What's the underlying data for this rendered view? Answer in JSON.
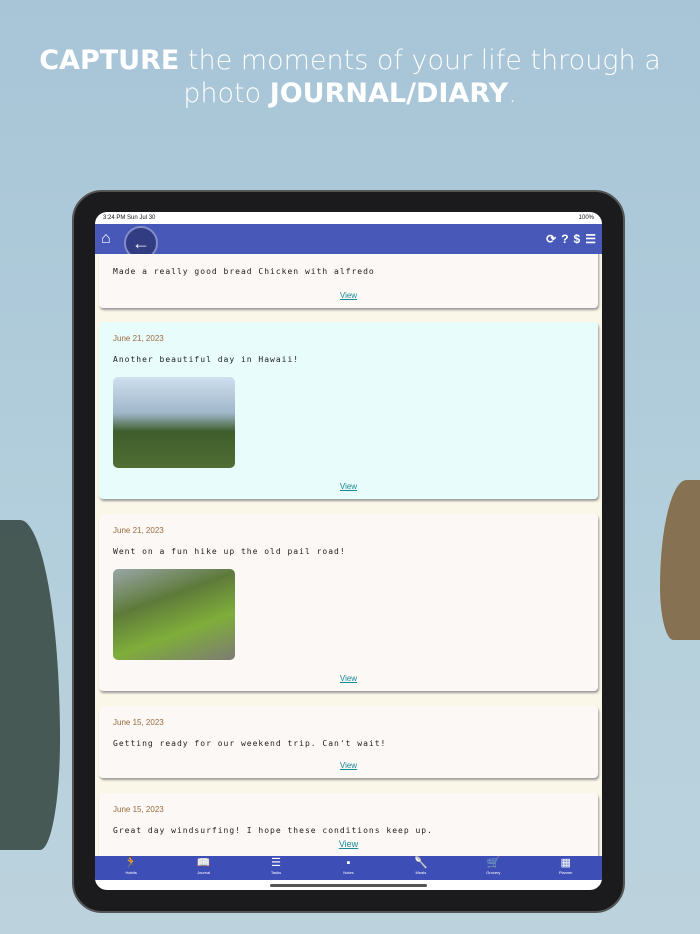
{
  "headline": {
    "strong1": "CAPTURE",
    "mid": " the moments of your life through a photo ",
    "strong2": "JOURNAL/DIARY",
    "end": "."
  },
  "status": {
    "time": "3:24 PM  Sun Jul 30",
    "battery": "100%"
  },
  "topbar": {
    "home": "⌂",
    "back": "←",
    "icons": [
      "⟳",
      "?",
      "$",
      "☰"
    ]
  },
  "entries": [
    {
      "date": "",
      "text": "Made a really good bread Chicken with alfredo",
      "view": "View",
      "photo": false
    },
    {
      "date": "June 21, 2023",
      "text": "Another beautiful day in Hawaii!",
      "view": "View",
      "photo": true
    },
    {
      "date": "June 21, 2023",
      "text": "Went on a fun hike up the old pail road!",
      "view": "View",
      "photo": true
    },
    {
      "date": "June 15, 2023",
      "text": "Getting ready for our weekend trip. Can't wait!",
      "view": "View",
      "photo": false
    },
    {
      "date": "June 15, 2023",
      "text": "Great day windsurfing! I hope these conditions keep up.",
      "view": "View",
      "photo": false
    }
  ],
  "nav": [
    {
      "icon": "🏃",
      "label": "Habits"
    },
    {
      "icon": "📖",
      "label": "Journal"
    },
    {
      "icon": "☰",
      "label": "Tasks"
    },
    {
      "icon": "▪",
      "label": "Notes"
    },
    {
      "icon": "🥄",
      "label": "Meals"
    },
    {
      "icon": "🛒",
      "label": "Grocery"
    },
    {
      "icon": "▦",
      "label": "Planner"
    }
  ]
}
